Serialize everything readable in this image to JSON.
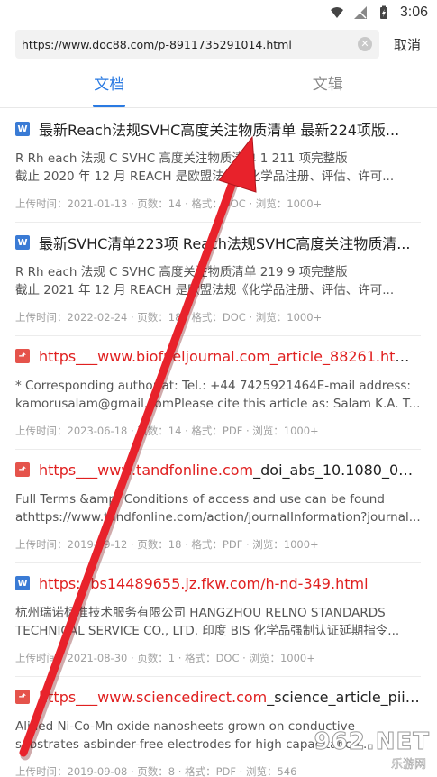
{
  "status_bar": {
    "time": "3:06",
    "icons": [
      "wifi-icon",
      "signal-icon",
      "battery-icon"
    ]
  },
  "url_bar": {
    "url": "https://www.doc88.com/p-8911735291014.html",
    "cancel_label": "取消"
  },
  "tabs": [
    {
      "label": "文档",
      "active": true
    },
    {
      "label": "文辑",
      "active": false
    }
  ],
  "results": [
    {
      "type": "word",
      "title_hl": "最新Reach法规SVHC高度关注物质清单",
      "title_rest": " 最新224项版...",
      "line1": "R Rh each 法规 C SVHC 高度关注物质清单  1 211 项完整版",
      "line2": "截止 2020 年 12 月 REACH 是欧盟法规《化学品注册、评估、许可...",
      "meta": "上传时间：2021-01-13 · 页数：14 · 格式：DOC · 浏览：1000+"
    },
    {
      "type": "word",
      "title_hl": "最新SVHC清单223项 Reach法规SVHC高度关注物质清...",
      "title_rest": "",
      "line1": "R Rh each 法规 C SVHC 高度关注物质清单  219 9 项完整版",
      "line2": "截止 2021 年 12 月 REACH 是欧盟法规《化学品注册、评估、许可...",
      "meta": "上传时间：2022-02-24 · 页数：18 · 格式：DOC · 浏览：1000+"
    },
    {
      "type": "pdf",
      "title_hl": "https___www.biofueljournal.com_article_88261.html_...",
      "title_rest": "",
      "line1": "* Corresponding author at: Tel.: +44 7425921464E-mail address:",
      "line2": "kamorusalam@gmail.comPlease cite this article as: Salam K.A. T...",
      "meta": "上传时间：2023-06-18 · 页数：14 · 格式：PDF · 浏览：1000+"
    },
    {
      "type": "pdf",
      "title_hl": "https___www.tandfonline.com",
      "title_rest": "_doi_abs_10.1080_0020...",
      "line1": "Full Terms &amp; Conditions of access and use can be found",
      "line2": "athttps://www.tandfonline.com/action/journalInformation?journal...",
      "meta": "上传时间：2019-09-12 · 页数：18 · 格式：PDF · 浏览：1000+"
    },
    {
      "type": "word",
      "title_hl": "https://bs14489655.jz.fkw.com/h-nd-349.html",
      "title_rest": "",
      "line1": "杭州瑞诺标准技术服务有限公司 HANGZHOU RELNO STANDARDS",
      "line2": "TECHNICAL SERVICE CO., LTD.  印度 BIS 化学品强制认证延期指令...",
      "meta": "上传时间：2021-08-30 · 页数：1 · 格式：DOC · 浏览：1000+"
    },
    {
      "type": "pdf",
      "title_hl": "https___www.sciencedirect.com",
      "title_rest": "_science_article_pii_S...",
      "line1": "Alined Ni-Co-Mn oxide nanosheets grown on conductive",
      "line2": "substrates asbinder-free electrodes for high capacitance...",
      "meta": "上传时间：2019-09-08 · 页数：8 · 格式：PDF · 浏览：546"
    }
  ],
  "watermark": {
    "main": "962.NET",
    "sub": "乐游网"
  },
  "colors": {
    "accent": "#2a7ae2",
    "highlight": "#e02020",
    "arrow": "#e8222b"
  }
}
